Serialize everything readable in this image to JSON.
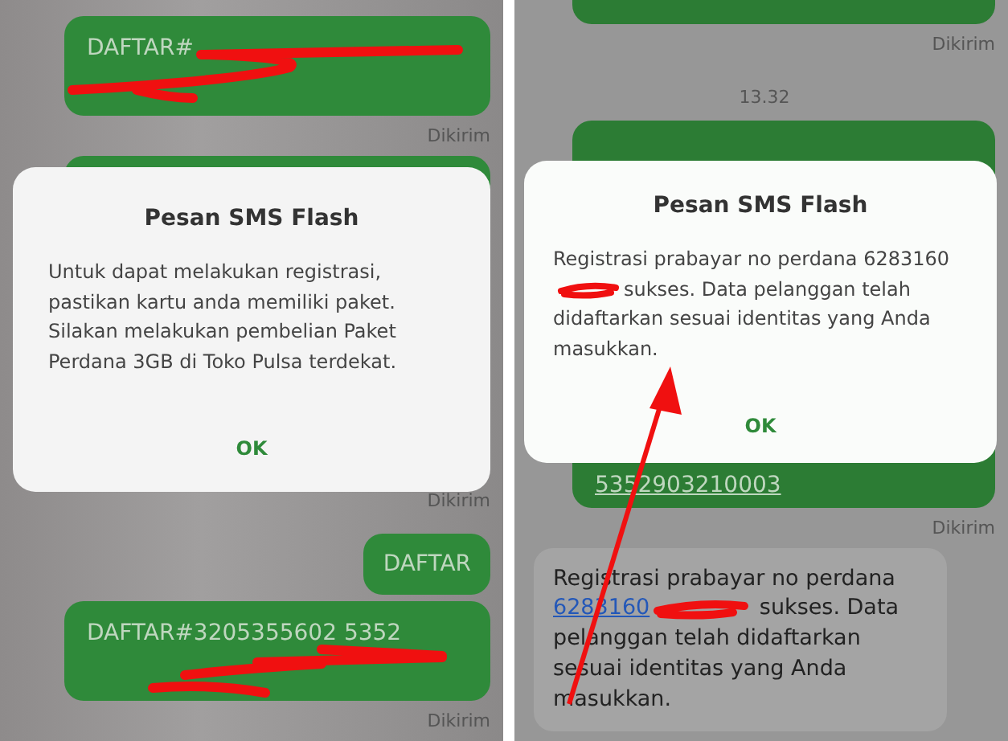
{
  "panels": [
    {
      "messages": [
        {
          "kind": "sent",
          "text": "DAFTAR#"
        },
        {
          "kind": "status",
          "text": "Dikirim"
        },
        {
          "kind": "hidden"
        },
        {
          "kind": "status",
          "text": "Dikirim"
        },
        {
          "kind": "short",
          "text": "DAFTAR"
        },
        {
          "kind": "sent",
          "text": "DAFTAR#3205355602 5352"
        },
        {
          "kind": "status",
          "text": "Dikirim"
        }
      ],
      "dialog": {
        "title": "Pesan SMS Flash",
        "body_before": "Untuk dapat melakukan registrasi, pastikan kartu anda memiliki paket. Silakan melakukan pembelian Paket Perdana 3GB di Toko Pulsa terdekat.",
        "button": "OK"
      }
    },
    {
      "messages": [
        {
          "kind": "cut"
        },
        {
          "kind": "status",
          "text": "Dikirim"
        },
        {
          "kind": "time",
          "text": "13.32"
        },
        {
          "kind": "hidden",
          "text": "5352903210003"
        },
        {
          "kind": "status",
          "text": "Dikirim"
        },
        {
          "kind": "received",
          "text": "Registrasi prabayar no perdana ",
          "link": "6283160",
          "text_after": " sukses. Data pelanggan telah didaftarkan sesuai identitas yang Anda masukkan."
        }
      ],
      "dialog": {
        "title": "Pesan SMS Flash",
        "body_before": "Registrasi prabayar no perdana 6283160",
        "body_after": "sukses. Data pelanggan telah didaftarkan sesuai identitas yang Anda masukkan.",
        "button": "OK"
      }
    }
  ]
}
